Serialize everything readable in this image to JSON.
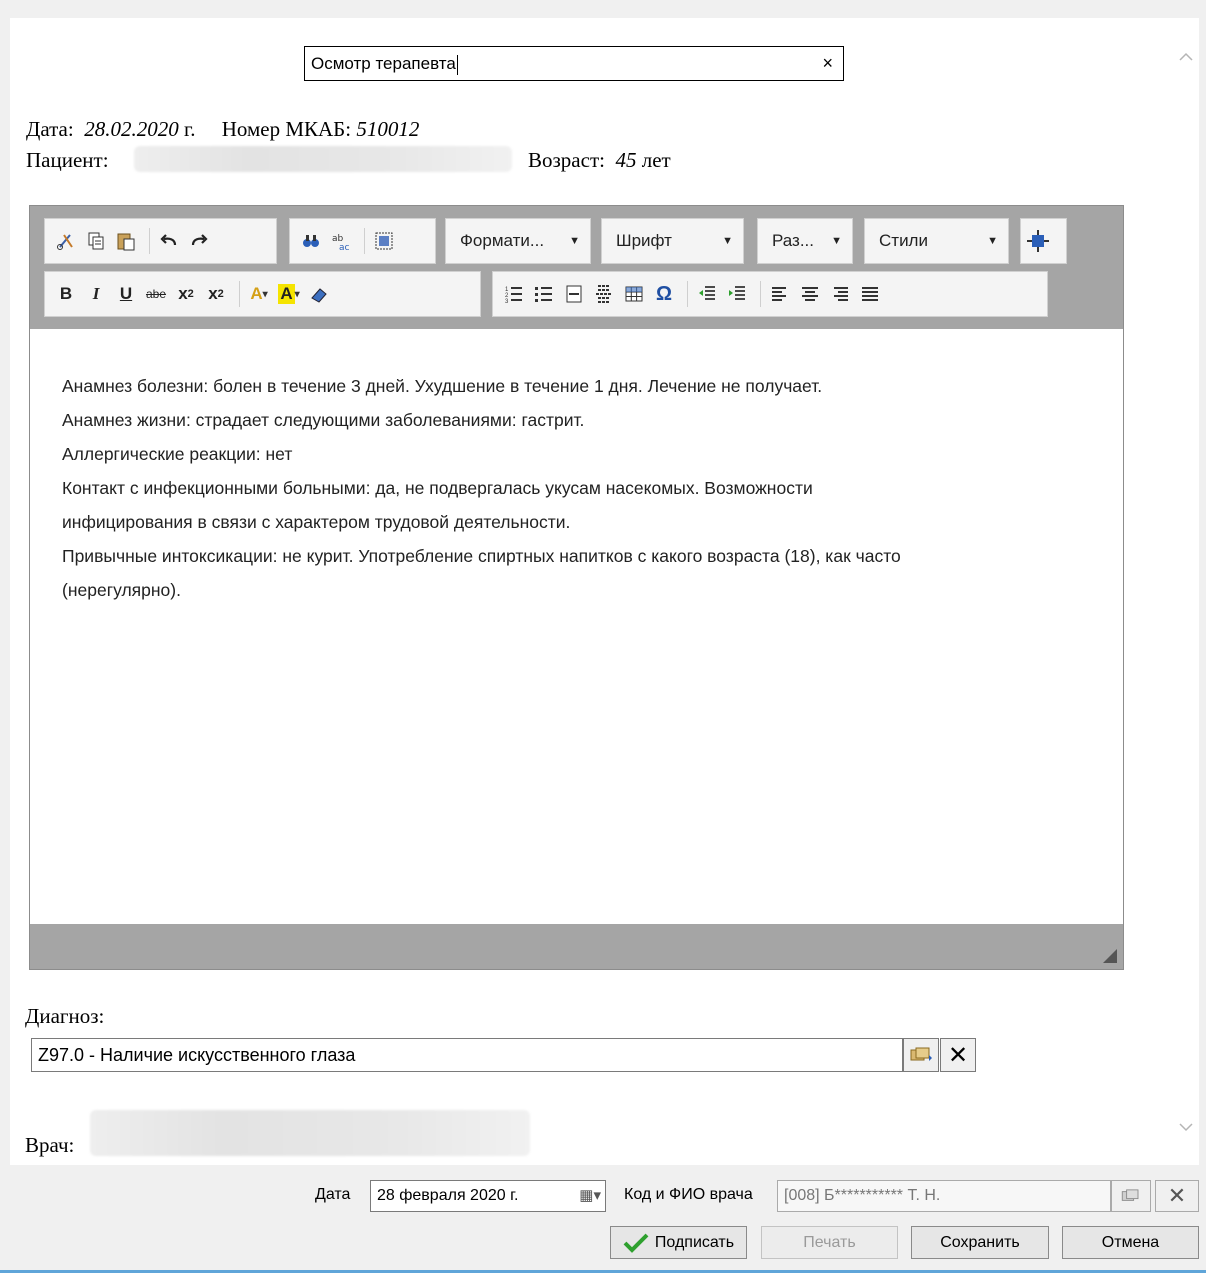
{
  "document": {
    "title": "Осмотр терапевта",
    "title_clear": "×",
    "date_label": "Дата:",
    "date_value": "28.02.2020",
    "date_suffix": "г.",
    "mkab_label": "Номер МКАБ:",
    "mkab_value": "510012",
    "patient_label": "Пациент:",
    "age_label": "Возраст:",
    "age_value": "45",
    "age_unit": "лет"
  },
  "toolbar": {
    "format_label": "Формати...",
    "font_label": "Шрифт",
    "size_label": "Раз...",
    "styles_label": "Стили",
    "bold": "B",
    "italic": "I",
    "underline": "U",
    "strike": "abe",
    "subscript_base": "x",
    "subscript_sub": "2",
    "superscript_base": "x",
    "superscript_sup": "2",
    "text_color": "A",
    "bg_color": "A",
    "special_char": "Ω"
  },
  "editor": {
    "lines": [
      "Анамнез болезни: болен в течение 3 дней. Ухудшение в течение 1 дня. Лечение не получает.",
      "Анамнез жизни: страдает следующими заболеваниями: гастрит.",
      "Аллергические реакции: нет",
      "Контакт с инфекционными больными: да, не подвергалась укусам насекомых. Возможности",
      "инфицирования в связи с характером трудовой деятельности.",
      "Привычные интоксикации: не курит. Употребление спиртных напитков с какого возраста (18), как часто",
      "(нерегулярно)."
    ]
  },
  "diagnosis": {
    "label": "Диагноз:",
    "value": "Z97.0 - Наличие искусственного глаза",
    "clear": "✕"
  },
  "doctor": {
    "label": "Врач:"
  },
  "bottom_bar": {
    "date_label": "Дата",
    "date_value": "28 февраля 2020 г.",
    "doctor_label": "Код и ФИО врача",
    "doctor_value": "[008] Б*********** Т. Н.",
    "clear": "✕",
    "sign_label": "Подписать",
    "print_label": "Печать",
    "save_label": "Сохранить",
    "cancel_label": "Отмена"
  },
  "colors": {
    "toolbar_bg": "#a5a5a5",
    "sign_check": "#2ea02e",
    "window_accent": "#5fa5d9"
  }
}
